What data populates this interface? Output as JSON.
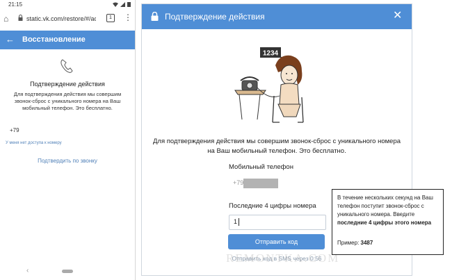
{
  "mobile": {
    "status_time": "21:15",
    "url": "static.vk.com/restore/#/ac",
    "tab_count": "1",
    "appbar_title": "Восстановление",
    "heading": "Подтверждение действия",
    "description": "Для подтверждения действия мы совершим звонок-сброс с уникального номера на Ваш мобильный телефон. Это бесплатно.",
    "phone_prefix": "+79",
    "no_access_link": "У меня нет доступа к номеру",
    "confirm_link": "Подтвердить по звонку"
  },
  "dialog": {
    "title": "Подтверждение действия",
    "illustration_number": "1234",
    "description": "Для подтверждения действия мы совершим звонок-сброс с уникального номера на Ваш мобильный телефон. Это бесплатно.",
    "phone_label": "Мобильный телефон",
    "phone_prefix": "+79",
    "digits_label": "Последние 4 цифры номера",
    "digits_value": "1",
    "send_button": "Отправить код",
    "sms_timer": "Отправить код в SMS через 0:56"
  },
  "tooltip": {
    "text_part1": "В течение нескольких секунд на Ваш телефон поступит звонок-сброс с уникального номера. Введите ",
    "text_bold": "последние 4 цифры этого номера",
    "example_label": "Пример:",
    "example_value": "3487"
  },
  "watermark": "REMONTKA.COM",
  "colors": {
    "accent": "#4f8ed6",
    "link": "#5181b8"
  }
}
